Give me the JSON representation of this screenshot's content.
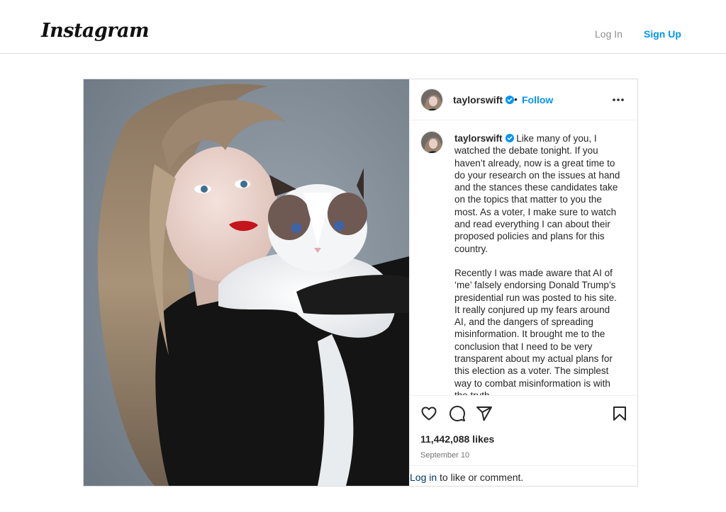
{
  "nav": {
    "logo": "Instagram",
    "login_label": "Log In",
    "signup_label": "Sign Up"
  },
  "post": {
    "username": "taylorswift",
    "verified": true,
    "separator": "•",
    "follow_label": "Follow",
    "more_icon": "more-options-icon",
    "caption_username": "taylorswift",
    "caption_p1": "Like many of you, I watched the debate tonight. If you haven’t already, now is a great time to do your research on the issues at hand and the stances these candidates take on the topics that matter to you the most. As a voter, I make sure to watch and read everything I can about their proposed policies and plans for this country.",
    "caption_p2": "Recently I was made aware that AI of ‘me’ falsely endorsing Donald Trump’s presidential run was posted to his site. It really conjured up my fears around AI, and the dangers of spreading misinformation. It brought me to the conclusion that I need to be very transparent about my actual plans for this election as a voter. The simplest way to combat misinformation is with the truth.",
    "likes": "11,442,088 likes",
    "date": "September 10",
    "login_prompt_link": "Log in",
    "login_prompt_rest": " to like or comment.",
    "icons": [
      "heart-icon",
      "comment-icon",
      "share-icon",
      "bookmark-icon"
    ]
  },
  "colors": {
    "accent": "#0095f6",
    "link": "#00376b",
    "muted": "#8e8e8e",
    "border": "#dbdbdb"
  }
}
